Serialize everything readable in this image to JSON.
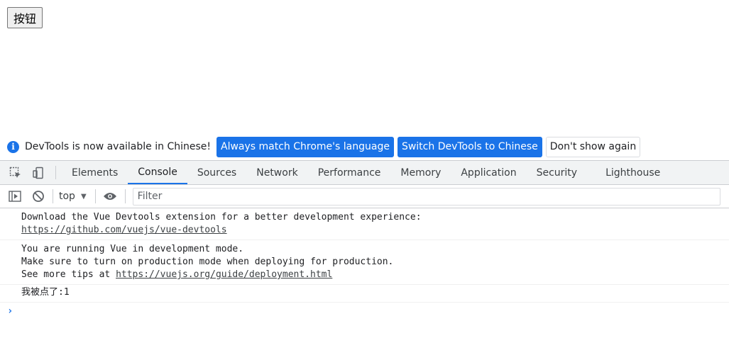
{
  "page": {
    "button_label": "按钮"
  },
  "infobar": {
    "message": "DevTools is now available in Chinese!",
    "buttons": [
      {
        "label": "Always match Chrome's language"
      },
      {
        "label": "Switch DevTools to Chinese"
      },
      {
        "label": "Don't show again"
      }
    ]
  },
  "tabs": [
    {
      "label": "Elements",
      "active": false
    },
    {
      "label": "Console",
      "active": true
    },
    {
      "label": "Sources",
      "active": false
    },
    {
      "label": "Network",
      "active": false
    },
    {
      "label": "Performance",
      "active": false
    },
    {
      "label": "Memory",
      "active": false
    },
    {
      "label": "Application",
      "active": false
    },
    {
      "label": "Security",
      "active": false
    },
    {
      "label": "Lighthouse",
      "active": false
    }
  ],
  "console_toolbar": {
    "context": "top",
    "filter_placeholder": "Filter"
  },
  "messages": [
    {
      "lines": [
        {
          "text": "Download the Vue Devtools extension for a better development experience:"
        },
        {
          "link": "https://github.com/vuejs/vue-devtools"
        }
      ]
    },
    {
      "lines": [
        {
          "text": "You are running Vue in development mode."
        },
        {
          "text": "Make sure to turn on production mode when deploying for production."
        },
        {
          "text": "See more tips at ",
          "link": "https://vuejs.org/guide/deployment.html"
        }
      ]
    },
    {
      "lines": [
        {
          "text": "我被点了:1"
        }
      ]
    }
  ],
  "colors": {
    "accent": "#1a73e8",
    "tabbar_bg": "#f1f3f4",
    "border": "#cbcdd1"
  },
  "icons": [
    "info-icon",
    "inspect-element-icon",
    "device-toggle-icon",
    "sidebar-toggle-icon",
    "clear-console-icon",
    "eye-icon",
    "prompt-caret-icon"
  ]
}
